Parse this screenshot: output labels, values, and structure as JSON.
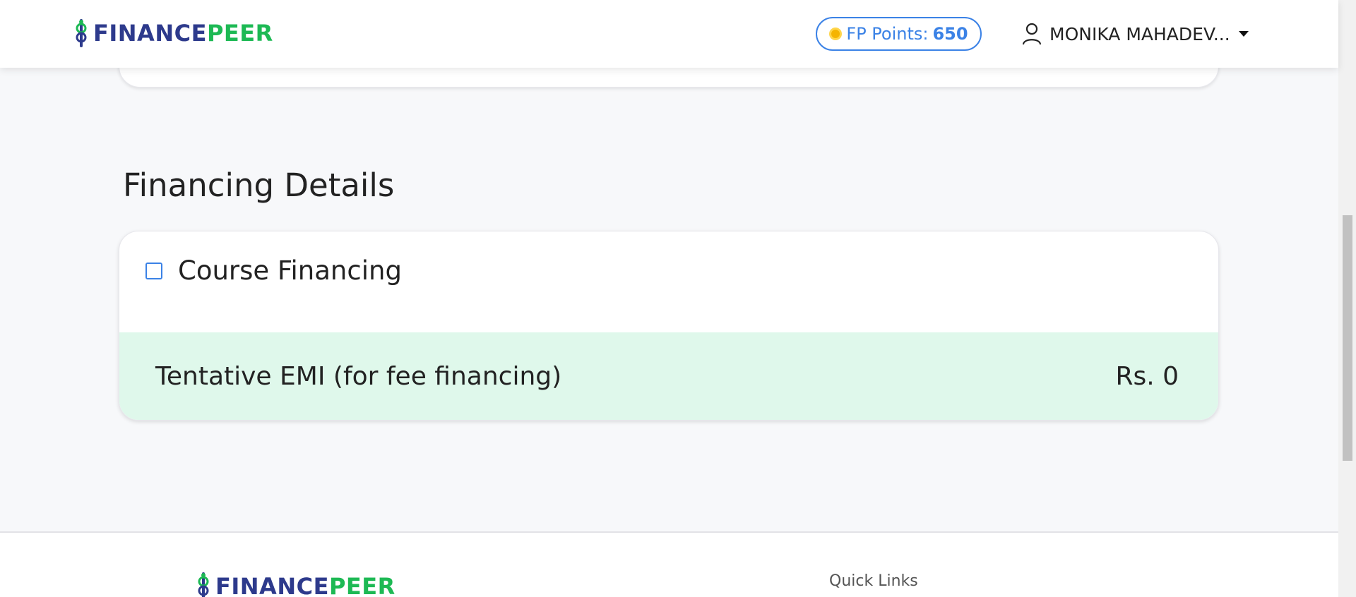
{
  "brand": {
    "part1": "FINANCE",
    "part2": "PEER",
    "color_primary": "#2d3a8c",
    "color_accent": "#1db954"
  },
  "header": {
    "points_label": "FP Points:",
    "points_value": "650",
    "user_name": "MONIKA MAHADEV...",
    "user_icon": "person-icon",
    "dropdown_icon": "caret-down-icon",
    "coin_icon": "coin-icon"
  },
  "financing": {
    "title": "Financing Details",
    "option_label": "Course Financing",
    "option_checked": false,
    "emi_label": "Tentative EMI (for fee financing)",
    "emi_value": "Rs. 0",
    "emi_bg_color": "#dff8eb"
  },
  "footer": {
    "quick_links": "Quick Links"
  }
}
